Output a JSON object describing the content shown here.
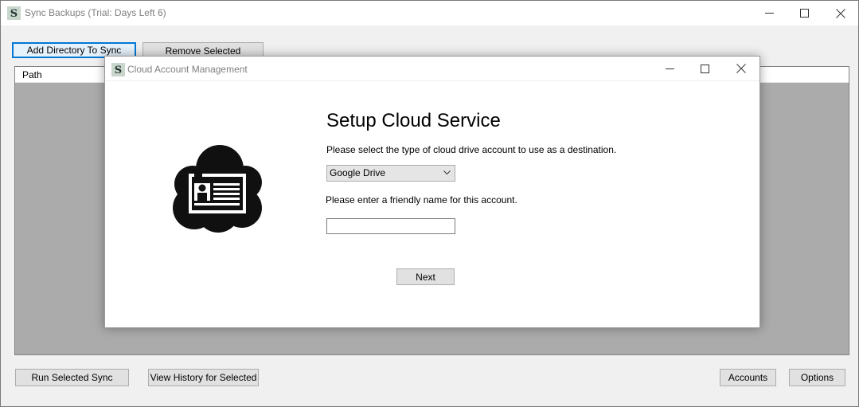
{
  "main": {
    "title": "Sync Backups (Trial: Days Left 6)",
    "icon_letter": "S",
    "toolbar": {
      "add_label": "Add Directory To Sync",
      "remove_label": "Remove Selected"
    },
    "list": {
      "columns": [
        "Path"
      ]
    },
    "footer": {
      "run_label": "Run Selected Sync",
      "history_label": "View History for Selected",
      "accounts_label": "Accounts",
      "options_label": "Options"
    }
  },
  "dialog": {
    "title": "Cloud Account Management",
    "icon_letter": "S",
    "heading": "Setup Cloud Service",
    "type_prompt": "Please select the type of cloud drive account to use as a destination.",
    "service_selected": "Google Drive",
    "name_prompt": "Please enter a friendly name for this account.",
    "name_value": "",
    "next_label": "Next"
  },
  "colors": {
    "window_bg": "#f0f0f0",
    "focus_border": "#0078d7",
    "list_bg": "#ababab"
  },
  "icons": [
    "minimize-icon",
    "maximize-icon",
    "close-icon",
    "chevron-down-icon",
    "cloud-id-card-icon"
  ]
}
